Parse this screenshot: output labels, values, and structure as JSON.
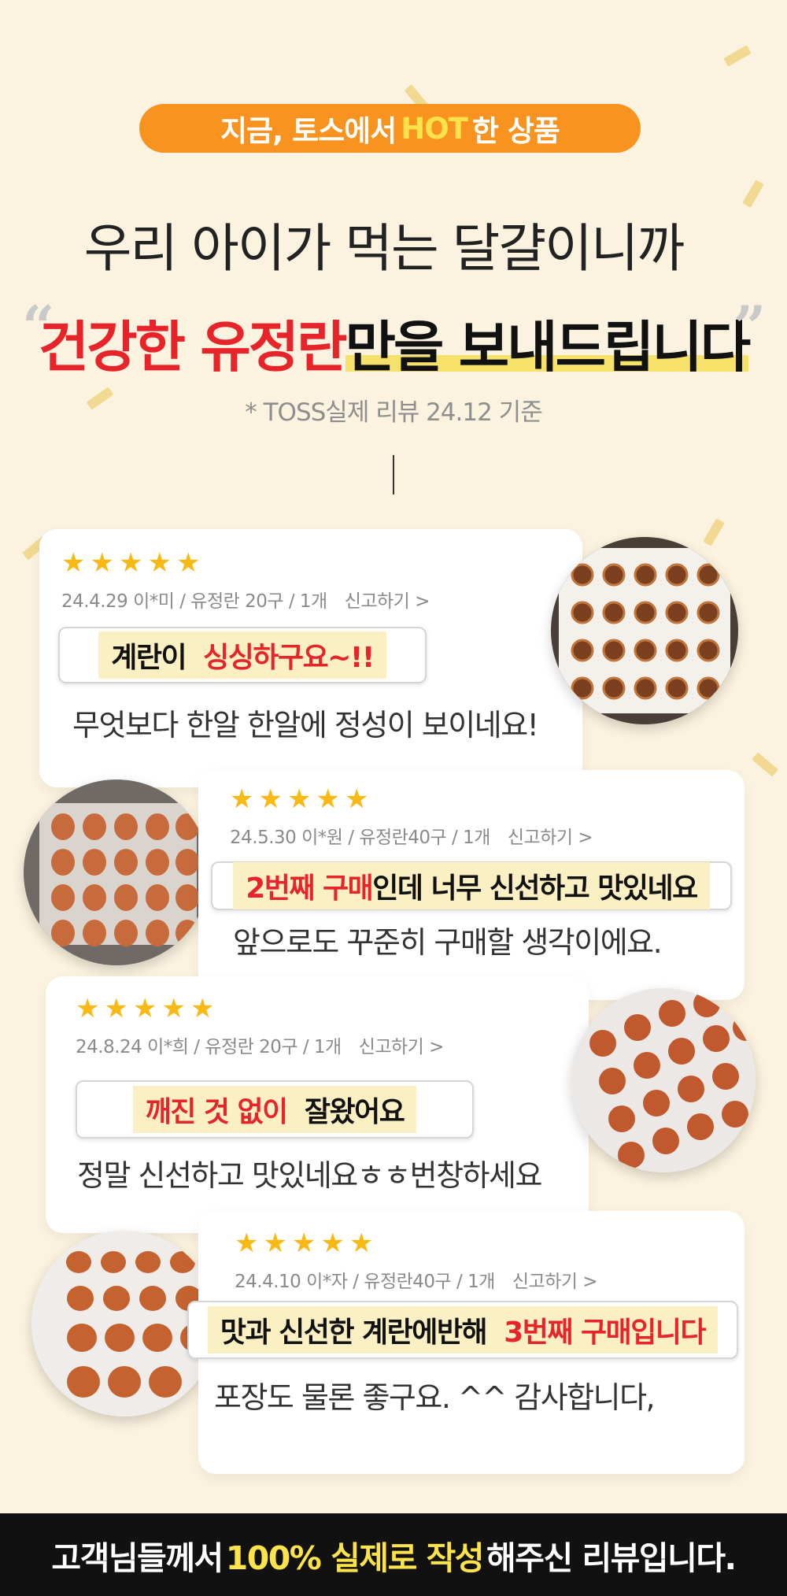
{
  "colors": {
    "background": "#fbf3df",
    "accent_orange": "#f7931e",
    "hot_yellow": "#ffe14a",
    "red": "#e8242b",
    "star": "#f9b914",
    "footer_bg": "#111111",
    "footer_highlight": "#fde34a"
  },
  "header": {
    "pill_prefix": "지금, 토스에서",
    "pill_hot": "HOT",
    "pill_suffix": "한 상품",
    "headline1": "우리 아이가 먹는 달걀이니까",
    "headline2_red": "건강한 유정란",
    "headline2_rest": "만을 보내드립니다",
    "open_quote": "“",
    "close_quote": "”",
    "note": "* TOSS실제 리뷰 24.12 기준"
  },
  "reviews": [
    {
      "rating": 5,
      "meta": "24.4.29 이*미 / 유정란 20구 / 1개",
      "report": "신고하기 >",
      "highlight_plain": "계란이",
      "highlight_red": "싱싱하구요~!!",
      "body": "무엇보다 한알 한알에 정성이 보이네요!",
      "photo_icon": "egg-tray-photo"
    },
    {
      "rating": 5,
      "meta": "24.5.30 이*원 / 유정란40구 / 1개",
      "report": "신고하기 >",
      "highlight_red": "2번째 구매",
      "highlight_plain": "인데 너무 신선하고 맛있네요",
      "body": "앞으로도 꾸준히 구매할 생각이에요.",
      "photo_icon": "egg-tray-photo"
    },
    {
      "rating": 5,
      "meta": "24.8.24 이*희 / 유정란 20구 / 1개",
      "report": "신고하기 >",
      "highlight_red": "깨진 것 없이",
      "highlight_plain": "잘왔어요",
      "body": "정말 신선하고 맛있네요ㅎㅎ번창하세요",
      "photo_icon": "egg-tray-photo"
    },
    {
      "rating": 5,
      "meta": "24.4.10 이*자 / 유정란40구 / 1개",
      "report": "신고하기 >",
      "highlight_plain": "맛과 신선한 계란에반해",
      "highlight_red": "3번째 구매입니다",
      "body": "포장도 물론 좋구요. ^^ 감사합니다,",
      "photo_icon": "egg-tray-photo"
    }
  ],
  "footer": {
    "prefix": "고객님들께서",
    "highlight": "100% 실제로 작성",
    "suffix": "해주신 리뷰입니다."
  }
}
